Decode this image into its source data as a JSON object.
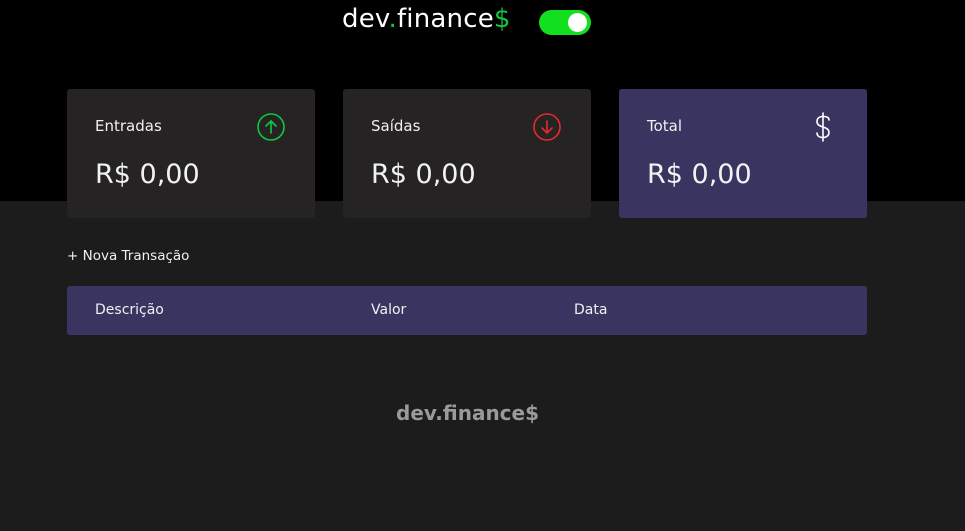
{
  "header": {
    "logo_prefix": "dev",
    "logo_dot": ".",
    "logo_name": "finance",
    "logo_dollar": "$",
    "theme_toggle": {
      "state": "on",
      "color": "#12e01f"
    }
  },
  "cards": {
    "income": {
      "label": "Entradas",
      "amount": "R$ 0,00",
      "icon": "arrow-up-circle-icon",
      "icon_color": "#12c640"
    },
    "expense": {
      "label": "Saídas",
      "amount": "R$ 0,00",
      "icon": "arrow-down-circle-icon",
      "icon_color": "#e92929"
    },
    "total": {
      "label": "Total",
      "amount": "R$ 0,00",
      "icon": "dollar-icon",
      "accent": "#3a3560"
    }
  },
  "transactions": {
    "new_label": "+ Nova Transação",
    "columns": [
      "Descrição",
      "Valor",
      "Data"
    ],
    "rows": []
  },
  "footer": {
    "logo": "dev.finance$"
  }
}
